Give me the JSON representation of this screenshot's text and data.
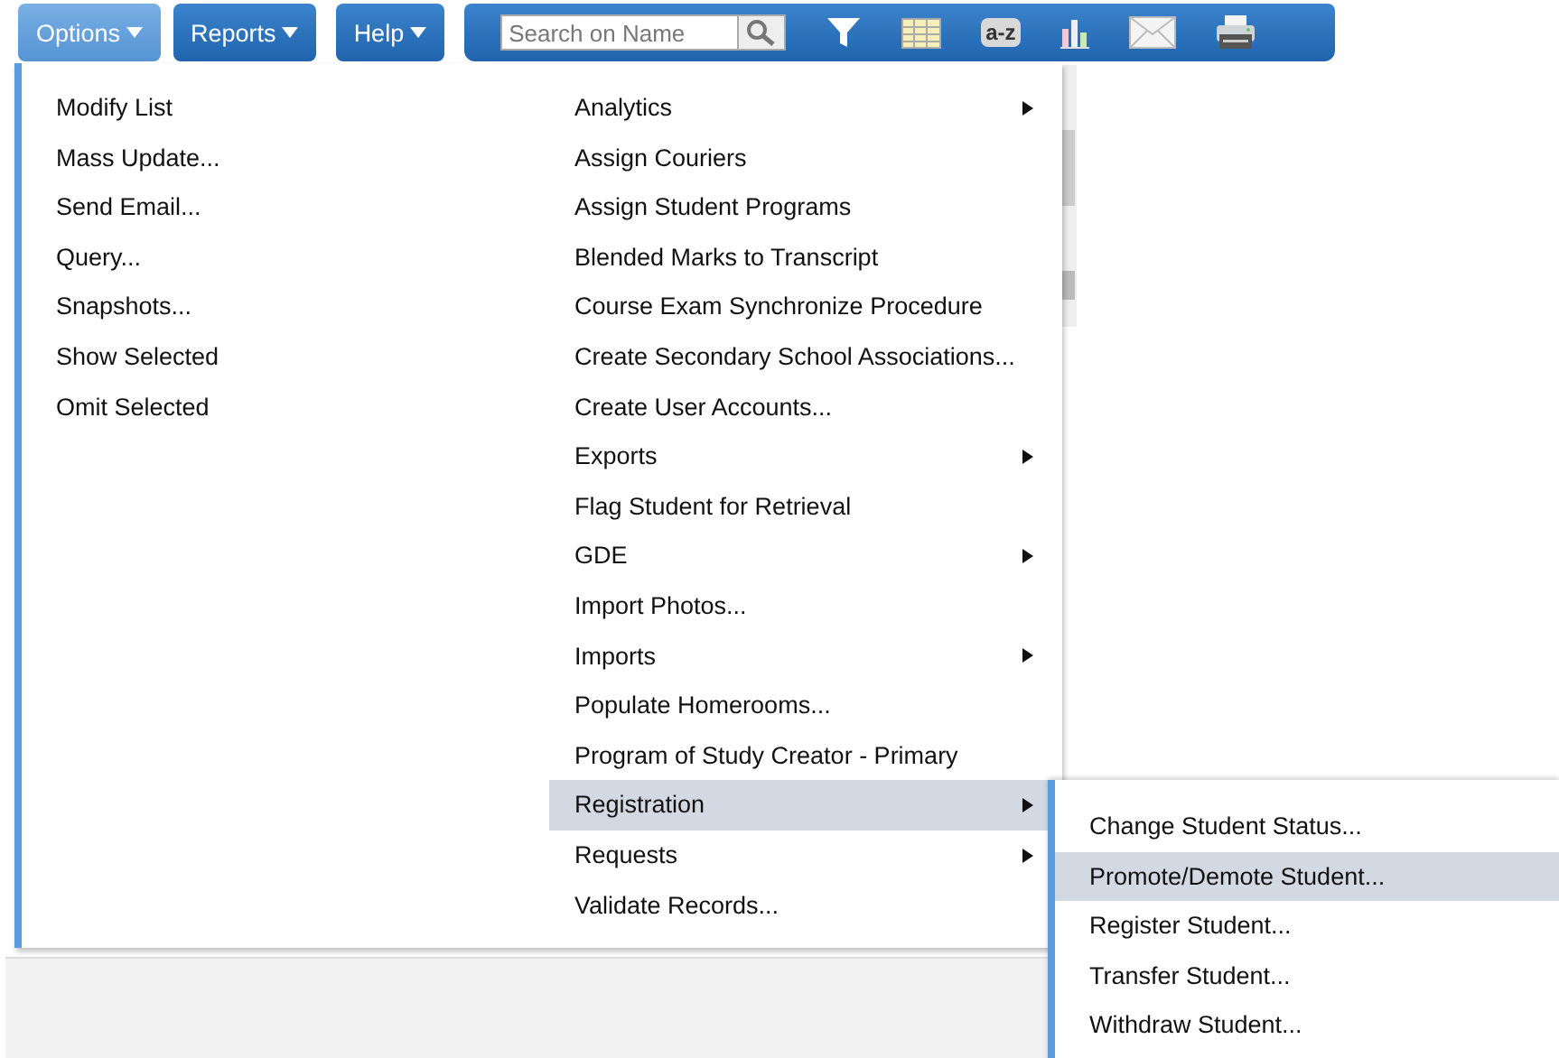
{
  "menu_buttons": [
    {
      "label": "Options",
      "selected": true
    },
    {
      "label": "Reports",
      "selected": false
    },
    {
      "label": "Help",
      "selected": false
    }
  ],
  "search": {
    "placeholder": "Search on Name"
  },
  "sort_icon_label": "a-z",
  "options_menu": {
    "left_items": [
      {
        "label": "Modify List"
      },
      {
        "label": "Mass Update..."
      },
      {
        "label": "Send Email..."
      },
      {
        "label": "Query..."
      },
      {
        "label": "Snapshots..."
      },
      {
        "label": "Show Selected"
      },
      {
        "label": "Omit Selected"
      }
    ],
    "right_items": [
      {
        "label": "Analytics",
        "has_submenu": true,
        "selected": false
      },
      {
        "label": "Assign Couriers",
        "has_submenu": false,
        "selected": false
      },
      {
        "label": "Assign Student Programs",
        "has_submenu": false,
        "selected": false
      },
      {
        "label": "Blended Marks to Transcript",
        "has_submenu": false,
        "selected": false
      },
      {
        "label": "Course Exam Synchronize Procedure",
        "has_submenu": false,
        "selected": false
      },
      {
        "label": "Create Secondary School Associations...",
        "has_submenu": false,
        "selected": false
      },
      {
        "label": "Create User Accounts...",
        "has_submenu": false,
        "selected": false
      },
      {
        "label": "Exports",
        "has_submenu": true,
        "selected": false
      },
      {
        "label": "Flag Student for Retrieval",
        "has_submenu": false,
        "selected": false
      },
      {
        "label": "GDE",
        "has_submenu": true,
        "selected": false
      },
      {
        "label": "Import Photos...",
        "has_submenu": false,
        "selected": false
      },
      {
        "label": "Imports",
        "has_submenu": true,
        "selected": false
      },
      {
        "label": "Populate Homerooms...",
        "has_submenu": false,
        "selected": false
      },
      {
        "label": "Program of Study Creator - Primary",
        "has_submenu": false,
        "selected": false
      },
      {
        "label": "Registration",
        "has_submenu": true,
        "selected": true
      },
      {
        "label": "Requests",
        "has_submenu": true,
        "selected": false
      },
      {
        "label": "Validate Records...",
        "has_submenu": false,
        "selected": false
      }
    ]
  },
  "registration_submenu": [
    {
      "label": "Change Student Status...",
      "selected": false
    },
    {
      "label": "Promote/Demote Student...",
      "selected": true
    },
    {
      "label": "Register Student...",
      "selected": false
    },
    {
      "label": "Transfer Student...",
      "selected": false
    },
    {
      "label": "Withdraw Student...",
      "selected": false
    }
  ]
}
